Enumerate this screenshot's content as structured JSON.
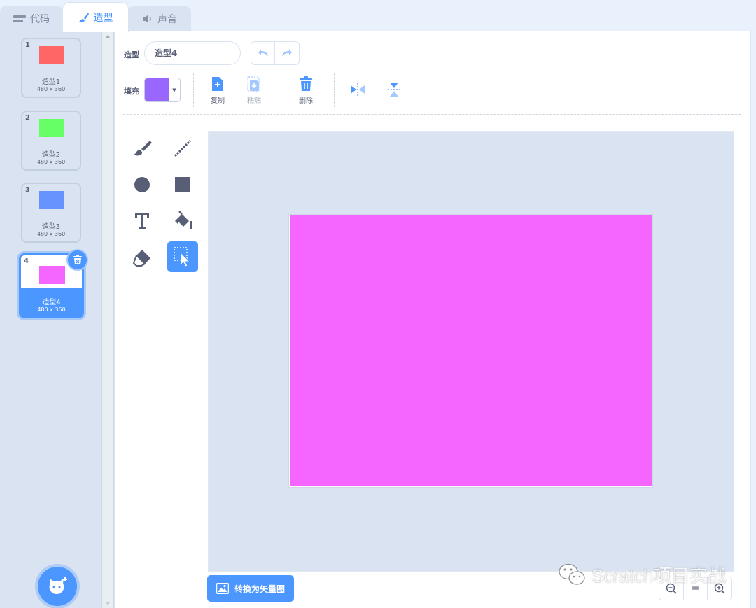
{
  "tabs": [
    {
      "label": "代码",
      "icon": "code-icon"
    },
    {
      "label": "造型",
      "icon": "paintbrush-icon",
      "active": true
    },
    {
      "label": "声音",
      "icon": "speaker-icon"
    }
  ],
  "costumes": [
    {
      "index": "1",
      "name": "造型1",
      "size": "480 x 360",
      "color": "#ff6666"
    },
    {
      "index": "2",
      "name": "造型2",
      "size": "480 x 360",
      "color": "#66ff66"
    },
    {
      "index": "3",
      "name": "造型3",
      "size": "480 x 360",
      "color": "#6694ff"
    },
    {
      "index": "4",
      "name": "造型4",
      "size": "480 x 360",
      "color": "#f466ff",
      "selected": true
    }
  ],
  "editor": {
    "costume_label": "造型",
    "costume_name": "造型4",
    "fill_label": "填充",
    "fill_color": "#9966ff",
    "copy_label": "复制",
    "paste_label": "粘贴",
    "delete_label": "删除",
    "canvas_fill": "#f466ff",
    "convert_label": "转换为矢量图",
    "zoom_reset_label": "="
  },
  "tools": [
    "brush-icon",
    "line-icon",
    "circle-icon",
    "rectangle-icon",
    "text-icon",
    "fill-bucket-icon",
    "eraser-icon",
    "select-icon"
  ],
  "watermark": "Scratch项目实战",
  "colors": {
    "accent": "#4c97ff",
    "panel": "#d9e3f2",
    "text": "#575e75"
  }
}
